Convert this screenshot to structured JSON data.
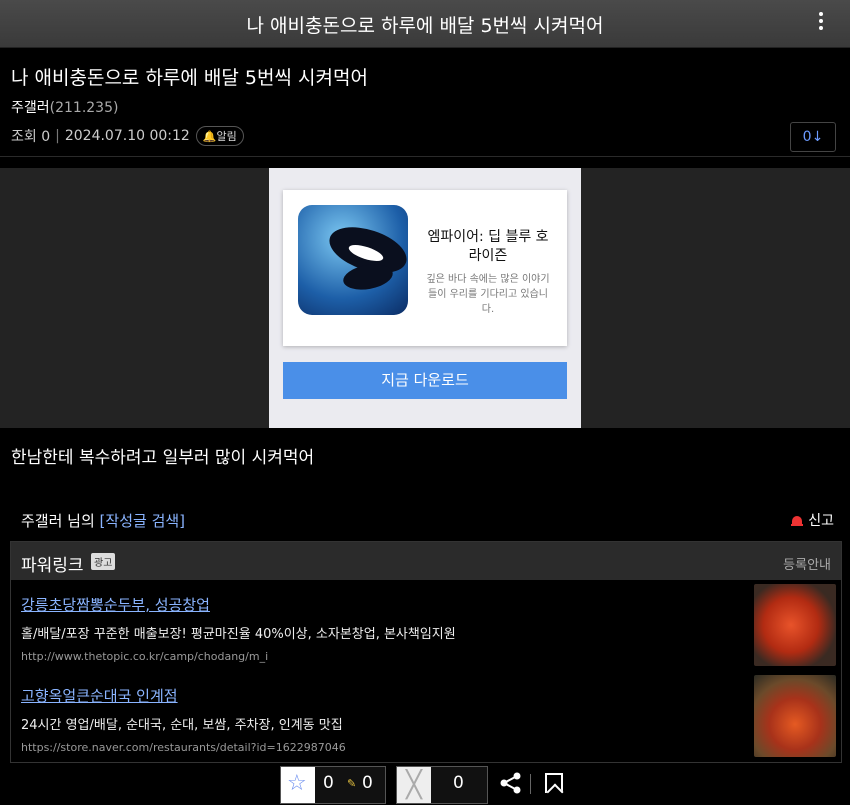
{
  "topbar": {
    "title": "나 애비충돈으로 하루에 배달 5번씩 시켜먹어"
  },
  "post": {
    "title": "나 애비충돈으로 하루에 배달 5번씩 시켜먹어",
    "author": "주갤러",
    "author_ip": "(211.235)",
    "views": "조회 0",
    "date": "2024.07.10 00:12",
    "alarm_label": "알림",
    "comment_count": "0↓",
    "body": "한남한테 복수하려고 일부러 많이 시켜먹어"
  },
  "ad": {
    "app_title": "엠파이어: 딥 블루 호라이즌",
    "app_desc": "깊은 바다 속에는 많은 이야기들이 우리를 기다리고 있습니다.",
    "download_label": "지금 다운로드"
  },
  "user_search": {
    "prefix": "주갤러 님의 ",
    "link": "[작성글 검색]"
  },
  "report_label": "신고",
  "powerlink": {
    "title": "파워링크",
    "badge": "광고",
    "register": "등록안내",
    "items": [
      {
        "headline": "강릉초당짬뽕순두부, 성공창업",
        "desc": "홀/배달/포장 꾸준한 매출보장! 평균마진율 40%이상, 소자본창업, 본사책임지원",
        "url": "http://www.thetopic.co.kr/camp/chodang/m_i"
      },
      {
        "headline": "고향옥얼큰순대국 인계점",
        "desc": "24시간 영업/배달, 순대국, 순대, 보쌈, 주차장, 인계동 맛집",
        "url": "https://store.naver.com/restaurants/detail?id=1622987046"
      }
    ]
  },
  "actions": {
    "recommend": "0",
    "fix_recommend": "0",
    "not_recommend": "0"
  },
  "colors": {
    "link": "#8ab4ff",
    "accent_button": "#4a8fe8",
    "report": "#e33333"
  }
}
